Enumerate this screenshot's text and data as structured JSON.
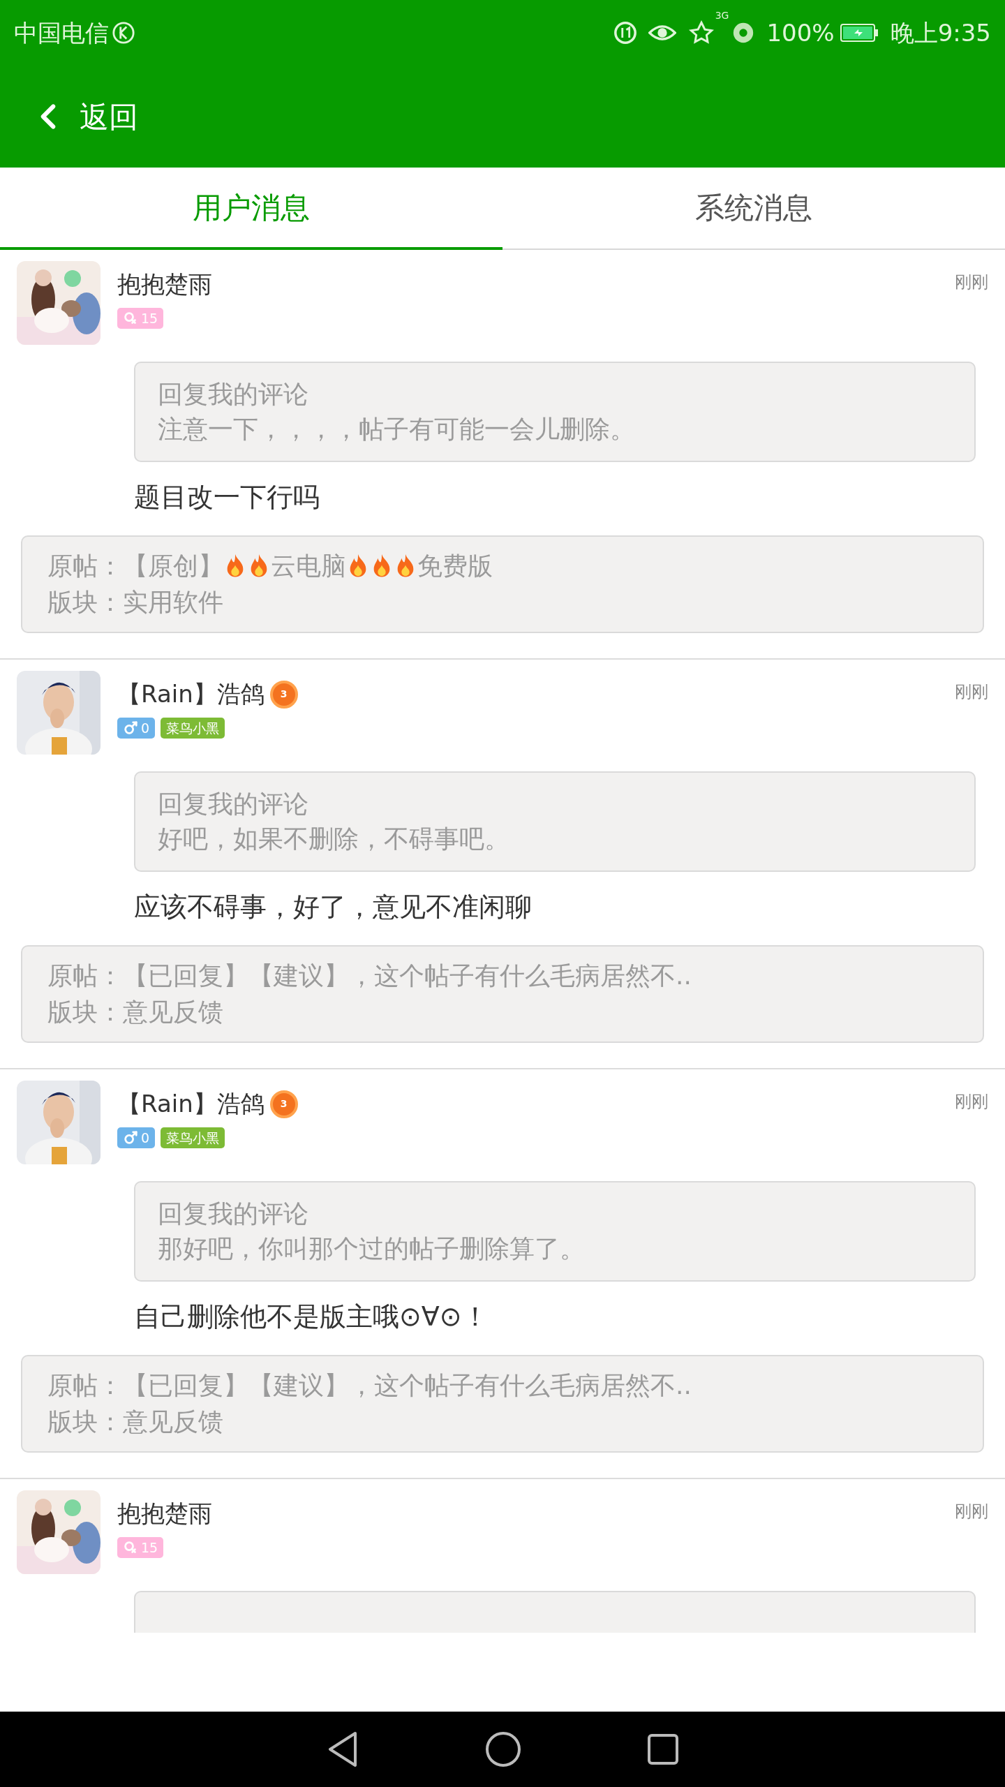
{
  "status_bar": {
    "carrier": "中国电信",
    "network": "3G",
    "battery": "100%",
    "time": "晚上9:35"
  },
  "header": {
    "back_label": "返回"
  },
  "tabs": [
    {
      "label": "用户消息",
      "selected": true
    },
    {
      "label": "系统消息",
      "selected": false
    }
  ],
  "messages": [
    {
      "name": "抱抱楚雨",
      "badge": {
        "kind": "female",
        "level": "15"
      },
      "time": "刚刚",
      "quote": {
        "label": "回复我的评论",
        "text": "注意一下，，，，帖子有可能一会儿删除。"
      },
      "reply": "题目改一下行吗",
      "post": {
        "title": [
          {
            "kind": "text",
            "text": "原帖：【原创】"
          },
          {
            "kind": "fire"
          },
          {
            "kind": "fire"
          },
          {
            "kind": "text",
            "text": "云电脑"
          },
          {
            "kind": "fire"
          },
          {
            "kind": "fire"
          },
          {
            "kind": "fire"
          },
          {
            "kind": "text",
            "text": "免费版"
          }
        ],
        "board": "版块：实用软件"
      }
    },
    {
      "name": "【Rain】浩鸽",
      "medal": "3",
      "badge": {
        "kind": "male",
        "level": "0"
      },
      "title_tag": "菜鸟小黑",
      "time": "刚刚",
      "quote": {
        "label": "回复我的评论",
        "text": "好吧，如果不删除，不碍事吧。"
      },
      "reply": "应该不碍事，好了，意见不准闲聊",
      "post": {
        "title": [
          {
            "kind": "text",
            "text": "原帖：【已回复】【建议】，这个帖子有什么毛病居然不.."
          }
        ],
        "board": "版块：意见反馈"
      }
    },
    {
      "name": "【Rain】浩鸽",
      "medal": "3",
      "badge": {
        "kind": "male",
        "level": "0"
      },
      "title_tag": "菜鸟小黑",
      "time": "刚刚",
      "quote": {
        "label": "回复我的评论",
        "text": "那好吧，你叫那个过的帖子删除算了。"
      },
      "reply": "自己删除他不是版主哦⊙∀⊙！",
      "post": {
        "title": [
          {
            "kind": "text",
            "text": "原帖：【已回复】【建议】，这个帖子有什么毛病居然不.."
          }
        ],
        "board": "版块：意见反馈"
      }
    },
    {
      "name": "抱抱楚雨",
      "badge": {
        "kind": "female",
        "level": "15"
      },
      "time": "刚刚"
    }
  ]
}
